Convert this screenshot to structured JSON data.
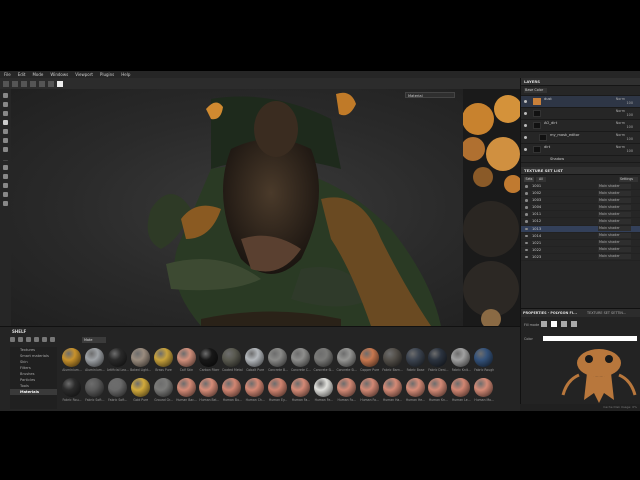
{
  "menu": [
    "File",
    "Edit",
    "Mode",
    "Windows",
    "Viewport",
    "Plugins",
    "Help"
  ],
  "viewport": {
    "mode_select": "Material",
    "camera_select": ""
  },
  "layers": {
    "title": "LAYERS",
    "blend_select": "Base Color",
    "rows": [
      {
        "name": "dust",
        "blend": "Norm",
        "opacity": "100",
        "thumb": "orange"
      },
      {
        "name": "",
        "blend": "Norm",
        "opacity": "100",
        "thumb": "dark"
      },
      {
        "name": "AO_dirt",
        "blend": "Norm",
        "opacity": "100",
        "thumb": "dark"
      },
      {
        "name": "my_mask_editor",
        "blend": "Norm",
        "opacity": "100",
        "thumb": "dark"
      },
      {
        "name": "dirt",
        "blend": "Norm",
        "opacity": "100",
        "thumb": "dark"
      },
      {
        "name": "Shadow",
        "blend": "",
        "opacity": "",
        "thumb": "dark"
      }
    ]
  },
  "texture_set_list": {
    "title": "TEXTURE SET LIST",
    "settings_label": "Settings",
    "tabs": [
      "Sets",
      "All"
    ],
    "rows": [
      {
        "name": "1001",
        "shader": "Main shader"
      },
      {
        "name": "1002",
        "shader": "Main shader"
      },
      {
        "name": "1003",
        "shader": "Main shader"
      },
      {
        "name": "1004",
        "shader": "Main shader"
      },
      {
        "name": "1011",
        "shader": "Main shader"
      },
      {
        "name": "1012",
        "shader": "Main shader"
      },
      {
        "name": "1013",
        "shader": "Main shader",
        "selected": true
      },
      {
        "name": "1014",
        "shader": "Main shader"
      },
      {
        "name": "1021",
        "shader": "Main shader"
      },
      {
        "name": "1022",
        "shader": "Main shader"
      },
      {
        "name": "1023",
        "shader": "Main shader"
      }
    ]
  },
  "properties": {
    "tab1": "PROPERTIES - POLYGON FI...",
    "tab2": "TEXTURE SET SETTIN...",
    "fill_mode_label": "Fill mode",
    "color_label": "Color"
  },
  "shelf": {
    "title": "SHELF",
    "search_value": "Mate",
    "categories": [
      "Textures",
      "Smart materials",
      "Skin",
      "Filters",
      "Brushes",
      "Particles",
      "Tools",
      "Materials"
    ],
    "selected_category": "Materials",
    "materials": [
      {
        "label": "Aluminium...",
        "color": "#c8922c"
      },
      {
        "label": "Aluminium...",
        "color": "#9ea2a6"
      },
      {
        "label": "Artificial Lea...",
        "color": "#2a2a2a"
      },
      {
        "label": "Baked Light...",
        "color": "#9a8c7e"
      },
      {
        "label": "Brass Pure",
        "color": "#c8a23c"
      },
      {
        "label": "Calf Skin",
        "color": "#d2907c"
      },
      {
        "label": "Carbon Fiber",
        "color": "#181818"
      },
      {
        "label": "Coated Metal",
        "color": "#5a5a50"
      },
      {
        "label": "Cobalt Pure",
        "color": "#b4b8bc"
      },
      {
        "label": "Concrete B...",
        "color": "#8a8a88"
      },
      {
        "label": "Concrete C...",
        "color": "#8e8e8c"
      },
      {
        "label": "Concrete Si...",
        "color": "#7a7a78"
      },
      {
        "label": "Concrete Si...",
        "color": "#969694"
      },
      {
        "label": "Copper Pure",
        "color": "#c87850"
      },
      {
        "label": "Fabric Barn...",
        "color": "#54504a"
      },
      {
        "label": "Fabric Base",
        "color": "#3c4450"
      },
      {
        "label": "Fabric Deni...",
        "color": "#2c3440"
      },
      {
        "label": "Fabric Knit...",
        "color": "#a0a0a0"
      },
      {
        "label": "Fabric Rough",
        "color": "#34527a"
      },
      {
        "label": "Fabric Rou...",
        "color": "#2c2c2c"
      },
      {
        "label": "Fabric Soft...",
        "color": "#5a5a5a"
      },
      {
        "label": "Fabric Soft...",
        "color": "#6a6a6a"
      },
      {
        "label": "Gold Pure",
        "color": "#d2aa3c"
      },
      {
        "label": "Ground Gr...",
        "color": "#7a7a78"
      },
      {
        "label": "Human Bac...",
        "color": "#d48a76"
      },
      {
        "label": "Human Bel...",
        "color": "#d68c78"
      },
      {
        "label": "Human Bu...",
        "color": "#d28672"
      },
      {
        "label": "Human Ch...",
        "color": "#d48874"
      },
      {
        "label": "Human Ey...",
        "color": "#d08470"
      },
      {
        "label": "Human Fa...",
        "color": "#d48a76"
      },
      {
        "label": "Human Fe...",
        "color": "#e0e0dc"
      },
      {
        "label": "Human Fo...",
        "color": "#d48a76"
      },
      {
        "label": "Human Fo...",
        "color": "#d28874"
      },
      {
        "label": "Human Ha...",
        "color": "#d48a76"
      },
      {
        "label": "Human He...",
        "color": "#d68c78"
      },
      {
        "label": "Human Kn...",
        "color": "#d48a76"
      },
      {
        "label": "Human Le...",
        "color": "#d28672"
      },
      {
        "label": "Human Mo...",
        "color": "#d48a76"
      }
    ]
  },
  "status": "Cache Disk Usage: 0%"
}
